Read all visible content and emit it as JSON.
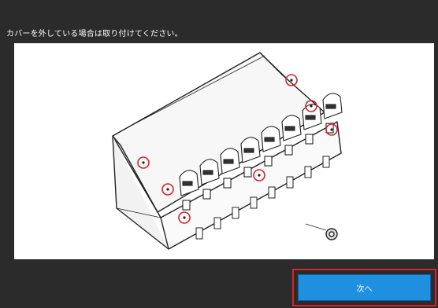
{
  "instruction": "カバーを外している場合は取り付けてください。",
  "illustration": {
    "icon": "machine-cover-screws-illustration",
    "highlight_color": "#d7232a"
  },
  "footer": {
    "next_label": "次へ",
    "accent_color": "#1f8fe0"
  }
}
